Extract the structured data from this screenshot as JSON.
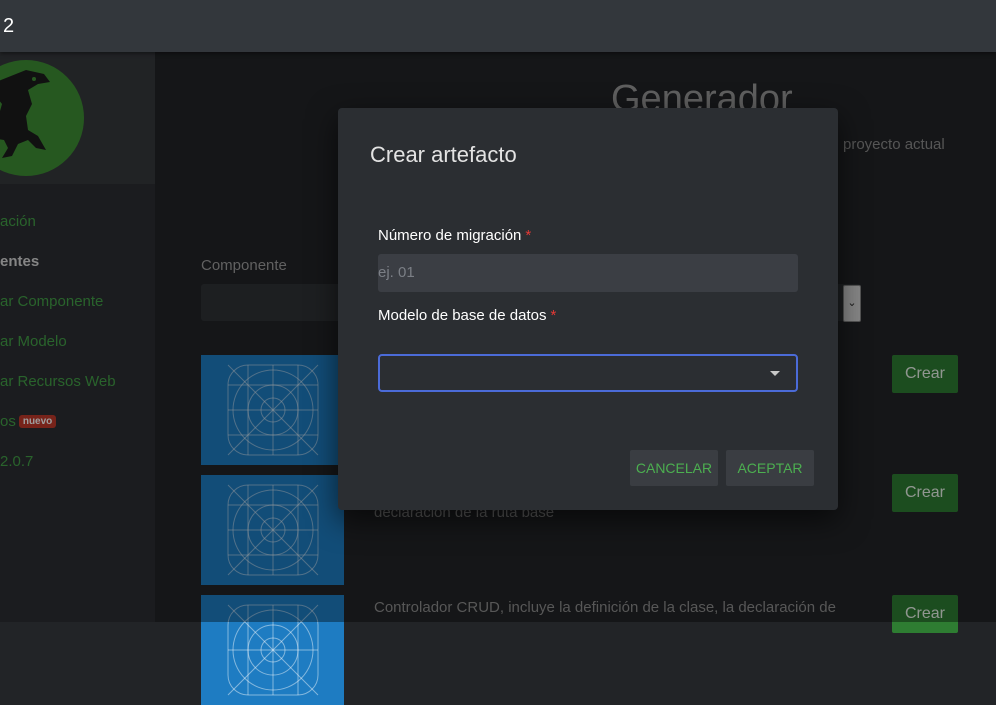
{
  "window": {
    "title": "2"
  },
  "sidebar": {
    "items": [
      {
        "label": "ación"
      },
      {
        "label": "entes"
      },
      {
        "label": "ar Componente"
      },
      {
        "label": "ar Modelo"
      },
      {
        "label": "ar Recursos Web"
      },
      {
        "label": "os",
        "badge": "nuevo"
      },
      {
        "label": "2.0.7"
      }
    ]
  },
  "main": {
    "title": "Generador",
    "subtitle": "proyecto actual",
    "component_label": "Componente",
    "cards": [
      {
        "description": "",
        "button": "Crear"
      },
      {
        "description": "declaración de la ruta base",
        "button": "Crear"
      },
      {
        "description": "Controlador CRUD, incluye la definición de la clase, la declaración de",
        "button": "Crear"
      }
    ]
  },
  "dialog": {
    "title": "Crear artefacto",
    "migration_label": "Número de migración",
    "migration_placeholder": "ej. 01",
    "model_label": "Modelo de base de datos",
    "required_mark": "*",
    "cancel": "CANCELAR",
    "accept": "ACEPTAR"
  },
  "colors": {
    "accent_green": "#43a047",
    "button_green": "#2e7d32",
    "focus_blue": "#4b6bd8",
    "badge_red": "#c0392b"
  },
  "icons": [
    "dinosaur-logo-icon",
    "app-icon-grid-icon",
    "chevron-down-icon",
    "dropdown-caret-icon"
  ]
}
